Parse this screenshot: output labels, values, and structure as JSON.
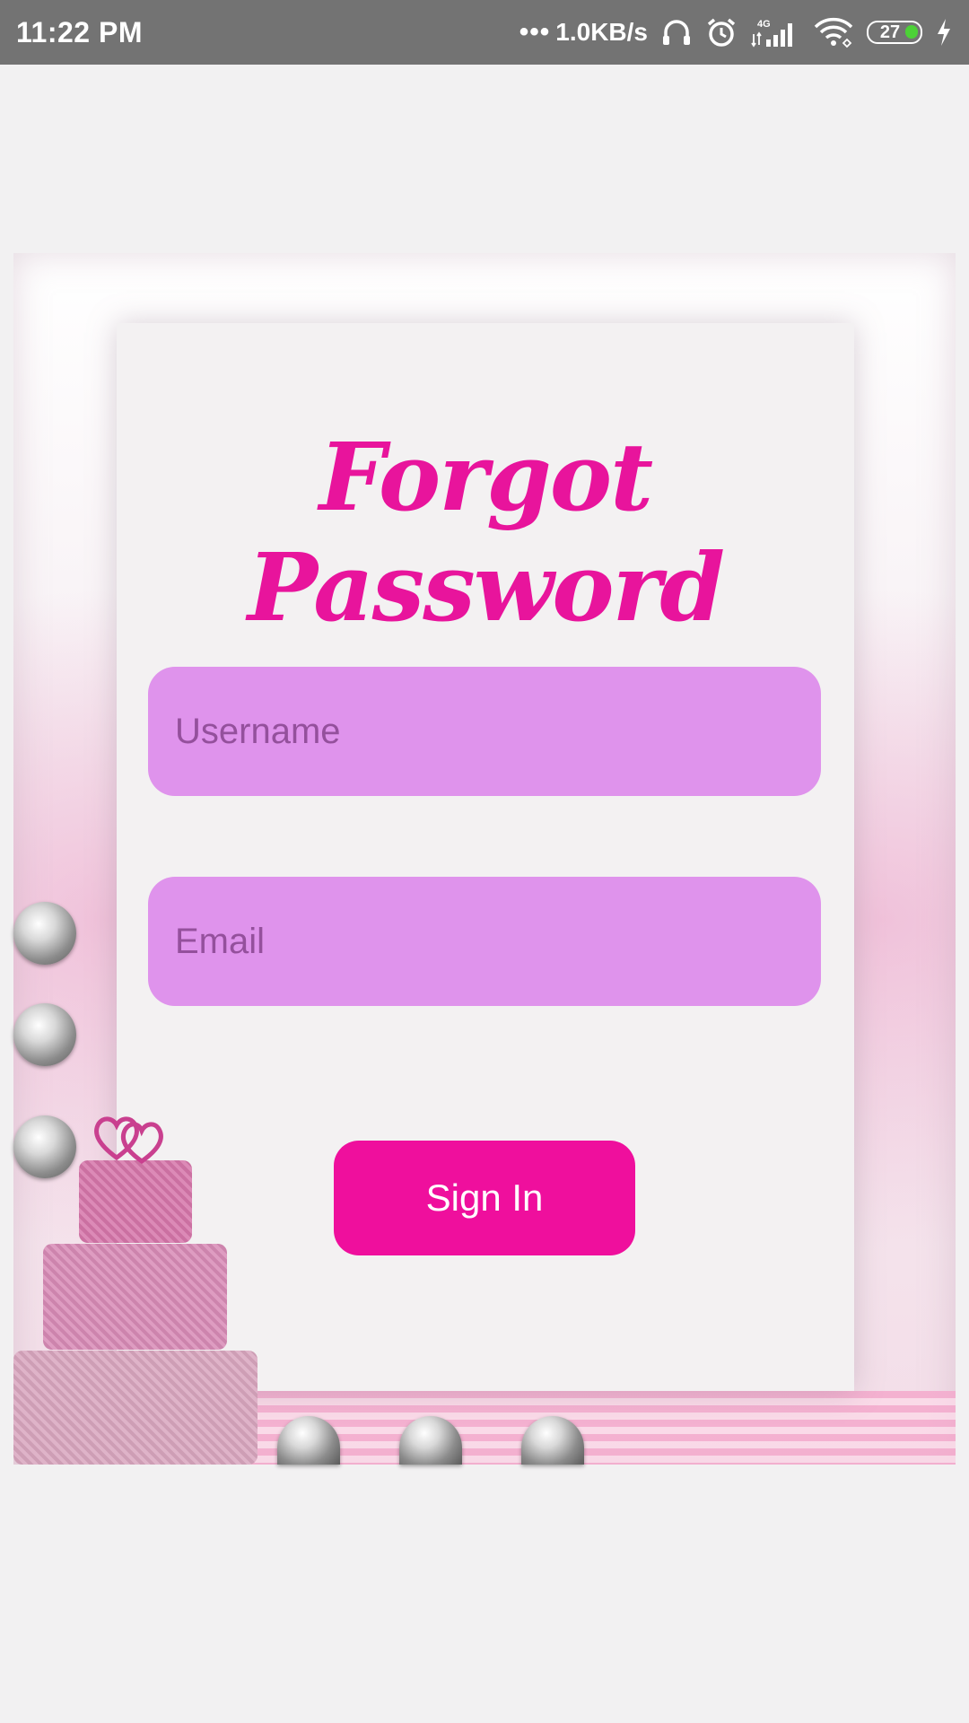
{
  "status_bar": {
    "time": "11:22 PM",
    "network_speed": "1.0KB/s",
    "network_type": "4G",
    "battery": "27",
    "icons": [
      "headphones-icon",
      "alarm-icon",
      "signal-icon",
      "wifi-icon",
      "battery-icon",
      "charging-icon"
    ]
  },
  "form": {
    "title": "Forgot Password",
    "username_placeholder": "Username",
    "email_placeholder": "Email",
    "sign_in_label": "Sign In"
  },
  "colors": {
    "title": "#e8149c",
    "input_background": "#df93ec",
    "button_background": "#ef0f9d",
    "page_background": "#f2f1f2"
  }
}
